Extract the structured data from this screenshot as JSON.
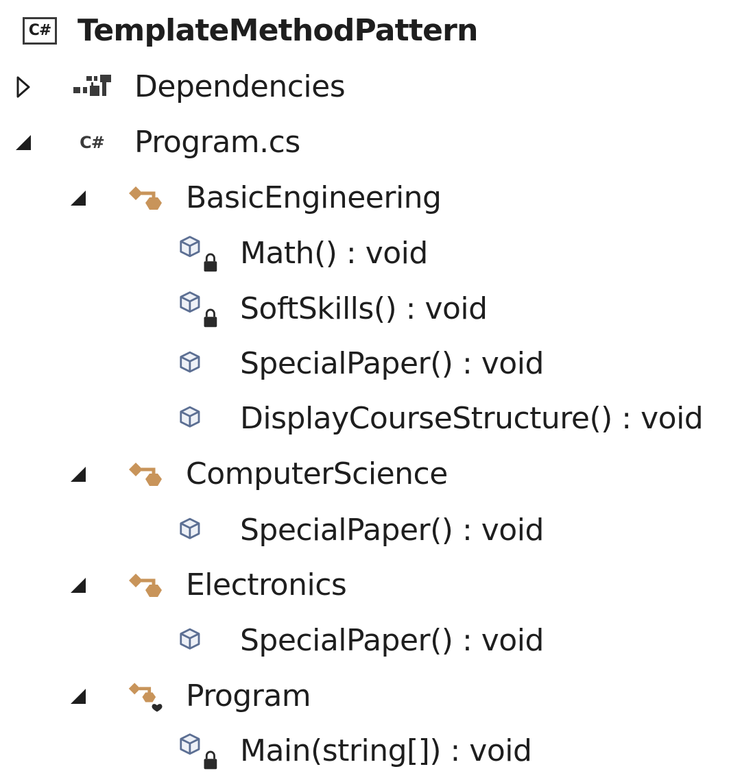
{
  "colors": {
    "text": "#1e1e1e",
    "class_icon": "#c8945a",
    "method_icon": "#5c6f93",
    "lock": "#2a2a2a"
  },
  "tree": {
    "project": {
      "name": "TemplateMethodPattern",
      "icon": "csharp-project-icon"
    },
    "dependencies": {
      "label": "Dependencies",
      "expanded": false,
      "icon": "dependencies-icon"
    },
    "file": {
      "label": "Program.cs",
      "expanded": true,
      "icon": "csharp-file-icon",
      "icon_text": "C#",
      "project_icon_text": "C#"
    },
    "classes": [
      {
        "name": "BasicEngineering",
        "expanded": true,
        "icon": "class-icon",
        "members": [
          {
            "label": "Math() : void",
            "icon": "method-icon",
            "access": "protected"
          },
          {
            "label": "SoftSkills() : void",
            "icon": "method-icon",
            "access": "protected"
          },
          {
            "label": "SpecialPaper() : void",
            "icon": "method-icon",
            "access": "public"
          },
          {
            "label": "DisplayCourseStructure() : void",
            "icon": "method-icon",
            "access": "public"
          }
        ]
      },
      {
        "name": "ComputerScience",
        "expanded": true,
        "icon": "class-icon",
        "members": [
          {
            "label": "SpecialPaper() : void",
            "icon": "method-icon",
            "access": "public"
          }
        ]
      },
      {
        "name": "Electronics",
        "expanded": true,
        "icon": "class-icon",
        "members": [
          {
            "label": "SpecialPaper() : void",
            "icon": "method-icon",
            "access": "public"
          }
        ]
      },
      {
        "name": "Program",
        "expanded": true,
        "icon": "internal-class-icon",
        "members": [
          {
            "label": "Main(string[]) : void",
            "icon": "method-icon",
            "access": "private"
          }
        ]
      }
    ]
  }
}
